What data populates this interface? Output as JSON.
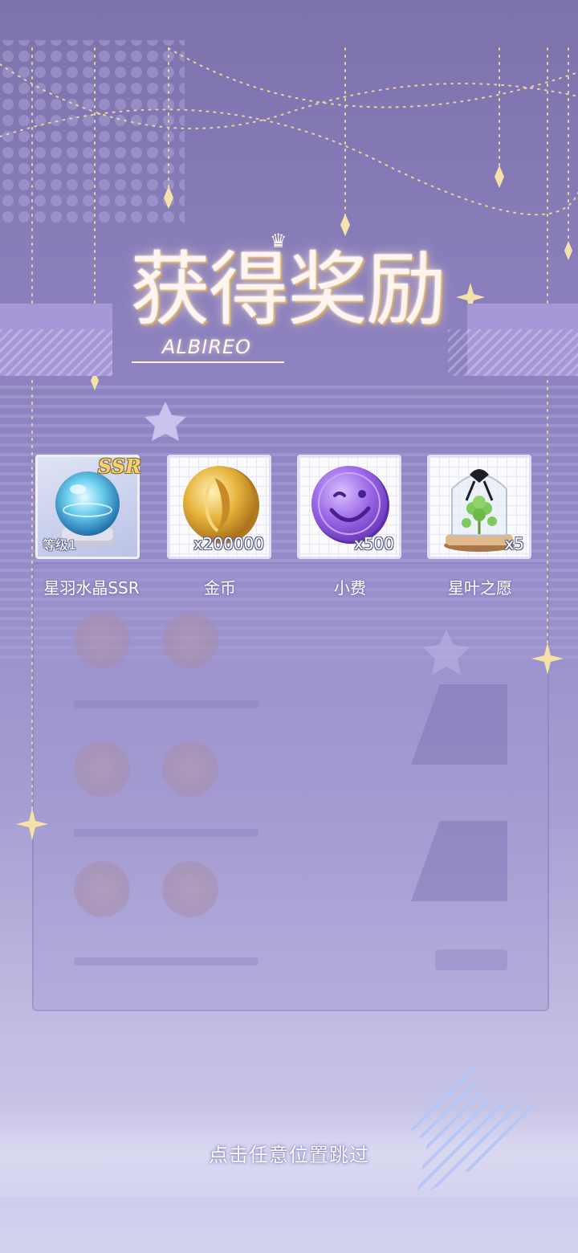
{
  "screen": {
    "title": "获得奖励",
    "subtitle": "ALBIREO",
    "skip_hint": "点击任意位置跳过"
  },
  "rewards": [
    {
      "name": "星羽水晶SSR",
      "rarity": "SSR",
      "level_label": "等级1",
      "icon": "crystal-ball-icon",
      "quantity": ""
    },
    {
      "name": "金币",
      "quantity": "x200000",
      "icon": "gold-coin-icon"
    },
    {
      "name": "小费",
      "quantity": "x500",
      "icon": "purple-tip-coin-icon"
    },
    {
      "name": "星叶之愿",
      "quantity": "x5",
      "icon": "clover-glass-dome-icon"
    }
  ],
  "colors": {
    "background_top": "#7d72ac",
    "background_bottom": "#d3d2ee",
    "accent_purple": "#a897d8",
    "gold": "#e3b24a",
    "title_glow": "#fff5ee"
  }
}
